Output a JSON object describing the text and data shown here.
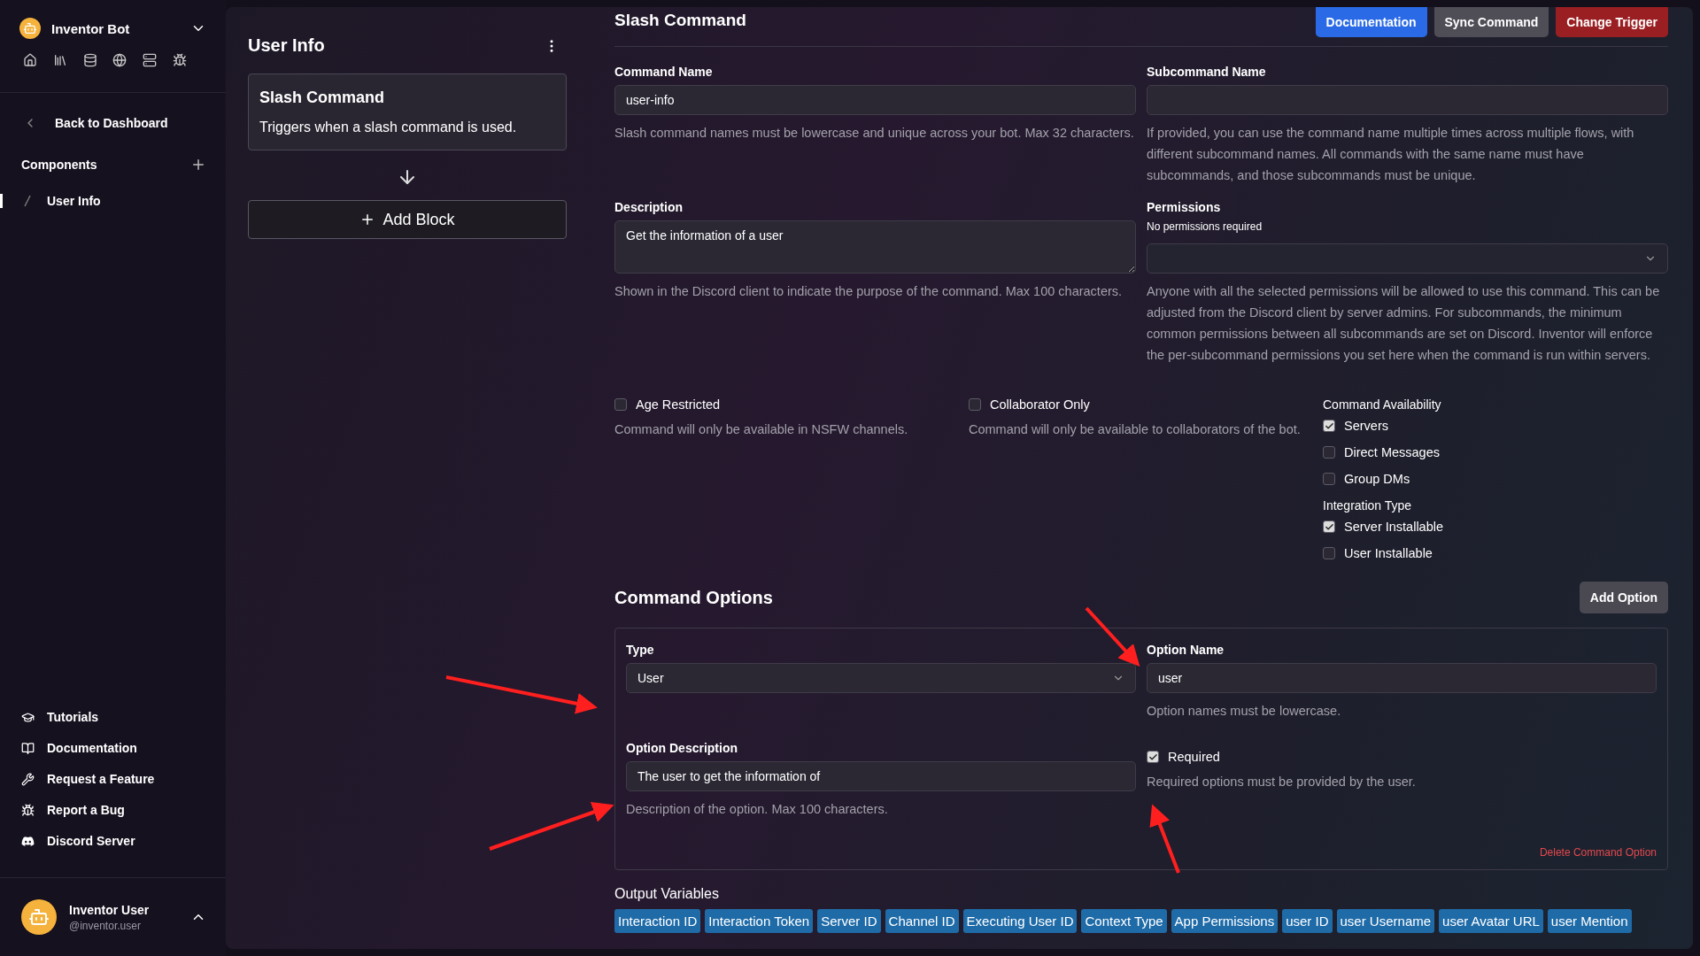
{
  "sidebar": {
    "bot_name": "Inventor Bot",
    "back_link": "Back to Dashboard",
    "components_label": "Components",
    "components": [
      {
        "label": "User Info",
        "selected": true
      }
    ],
    "footer_links": [
      "Tutorials",
      "Documentation",
      "Request a Feature",
      "Report a Bug",
      "Discord Server"
    ],
    "user": {
      "name": "Inventor User",
      "handle": "@inventor.user"
    }
  },
  "blocks": {
    "title": "User Info",
    "trigger": {
      "title": "Slash Command",
      "description": "Triggers when a slash command is used."
    },
    "add_block": "Add Block"
  },
  "editor": {
    "title": "Slash Command",
    "buttons": [
      {
        "label": "Documentation",
        "kind": "primary"
      },
      {
        "label": "Sync Command",
        "kind": "secondary"
      },
      {
        "label": "Change Trigger",
        "kind": "danger"
      }
    ],
    "command_name": {
      "label": "Command Name",
      "value": "user-info",
      "help": "Slash command names must be lowercase and unique across your bot. Max 32 characters."
    },
    "subcommand_name": {
      "label": "Subcommand Name",
      "help": "If provided, you can use the command name multiple times across multiple flows, with different subcommand names. All commands with the same name must have subcommands, and those subcommands must be unique."
    },
    "description": {
      "label": "Description",
      "value": "Get the information of a user",
      "help": "Shown in the Discord client to indicate the purpose of the command. Max 100 characters."
    },
    "permissions": {
      "label": "Permissions",
      "note": "No permissions required",
      "help": "Anyone with all the selected permissions will be allowed to use this command. This can be adjusted from the Discord client by server admins. For subcommands, the minimum common permissions between all subcommands are set on Discord. Inventor will enforce the per-subcommand permissions you set here when the command is run within servers."
    },
    "flags": [
      {
        "label": "Age Restricted",
        "checked": false,
        "help": "Command will only be available in NSFW channels."
      },
      {
        "label": "Collaborator Only",
        "checked": false,
        "help": "Command will only be available to collaborators of the bot."
      }
    ],
    "groups": [
      {
        "title": "Command Availability",
        "items": [
          {
            "label": "Servers",
            "checked": true
          },
          {
            "label": "Direct Messages",
            "checked": false
          },
          {
            "label": "Group DMs",
            "checked": false
          }
        ]
      },
      {
        "title": "Integration Type",
        "items": [
          {
            "label": "Server Installable",
            "checked": true
          },
          {
            "label": "User Installable",
            "checked": false
          }
        ]
      }
    ],
    "options_title": "Command Options",
    "add_option": "Add Option",
    "option": {
      "type_label": "Type",
      "type_value": "User",
      "name_label": "Option Name",
      "name_value": "user",
      "name_help": "Option names must be lowercase.",
      "description_label": "Option Description",
      "description_value": "The user to get the information of",
      "description_help": "Description of the option. Max 100 characters.",
      "required": {
        "label": "Required",
        "checked": true,
        "help": "Required options must be provided by the user."
      },
      "delete": "Delete Command Option"
    },
    "output_title": "Output Variables",
    "output_variables": [
      "Interaction ID",
      "Interaction Token",
      "Server ID",
      "Channel ID",
      "Executing User ID",
      "Context Type",
      "App Permissions",
      "user ID",
      "user Username",
      "user Avatar URL",
      "user Mention"
    ]
  }
}
